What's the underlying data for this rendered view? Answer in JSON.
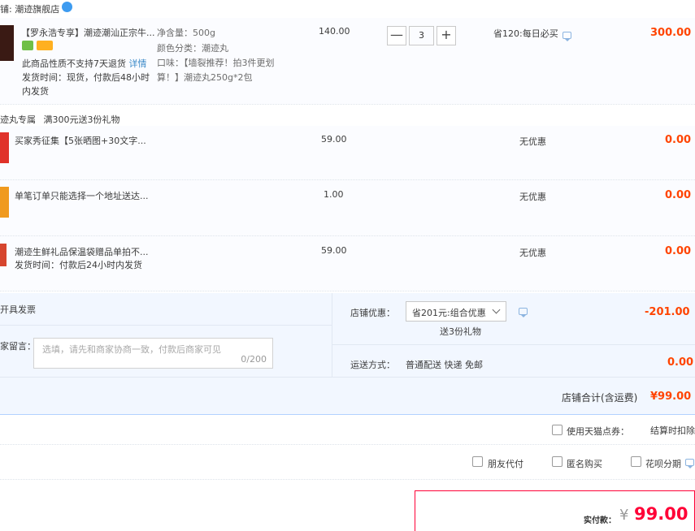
{
  "shop": {
    "label_prefix": "铺:",
    "name": "潮迹旗舰店"
  },
  "main_item": {
    "title": "【罗永浩专享】潮迹潮汕正宗牛...",
    "no_return": "此商品性质不支持7天退货",
    "detail_link": "详情",
    "ship_line1": "发货时间：现货，付款后48小时",
    "ship_line2": "内发货",
    "attr_weight": "净含量：500g",
    "attr_color": "颜色分类：潮迹丸",
    "attr_taste1": "口味：【墙裂推荐！拍3件更划",
    "attr_taste2": "算！】潮迹丸250g*2包",
    "price": "140.00",
    "qty": "3",
    "qty_minus": "—",
    "qty_plus": "+",
    "discount": "省120:每日必买",
    "subtotal": "300.00"
  },
  "promo": {
    "title": "迹丸专属",
    "desc": "满300元送3份礼物"
  },
  "gifts": [
    {
      "title": "买家秀征集【5张晒图+30文字...",
      "price": "59.00",
      "discount": "无优惠",
      "subtotal": "0.00"
    },
    {
      "title": "单笔订单只能选择一个地址送达...",
      "price": "1.00",
      "discount": "无优惠",
      "subtotal": "0.00"
    },
    {
      "title": "潮迹生鲜礼品保温袋赠品单拍不...",
      "sub": "发货时间：付款后24小时内发货",
      "price": "59.00",
      "discount": "无优惠",
      "subtotal": "0.00"
    }
  ],
  "invoice": {
    "label": "开具发票"
  },
  "message": {
    "label": "家留言：",
    "placeholder": "选填，请先和商家协商一致，付款后商家可见",
    "counter": "0/200"
  },
  "store_discount": {
    "label": "店铺优惠：",
    "selected": "省201元:组合优惠",
    "sub": "送3份礼物",
    "amount": "-201.00"
  },
  "shipping": {
    "label": "运送方式：",
    "value": "普通配送 快递 免邮",
    "amount": "0.00"
  },
  "store_total": {
    "label": "店铺合计(含运费)",
    "amount": "¥99.00"
  },
  "tmall_points": {
    "label": "使用天猫点券：",
    "note": "结算时扣除"
  },
  "options": {
    "friend_pay": "朋友代付",
    "anonymous": "匿名购买",
    "huabei": "花呗分期"
  },
  "payable": {
    "label": "实付款：",
    "currency": "¥",
    "amount": "99.00"
  },
  "colors": {
    "accent_red": "#ff4400",
    "pay_red": "#ff0036",
    "border_blue": "#b2d1ff"
  }
}
